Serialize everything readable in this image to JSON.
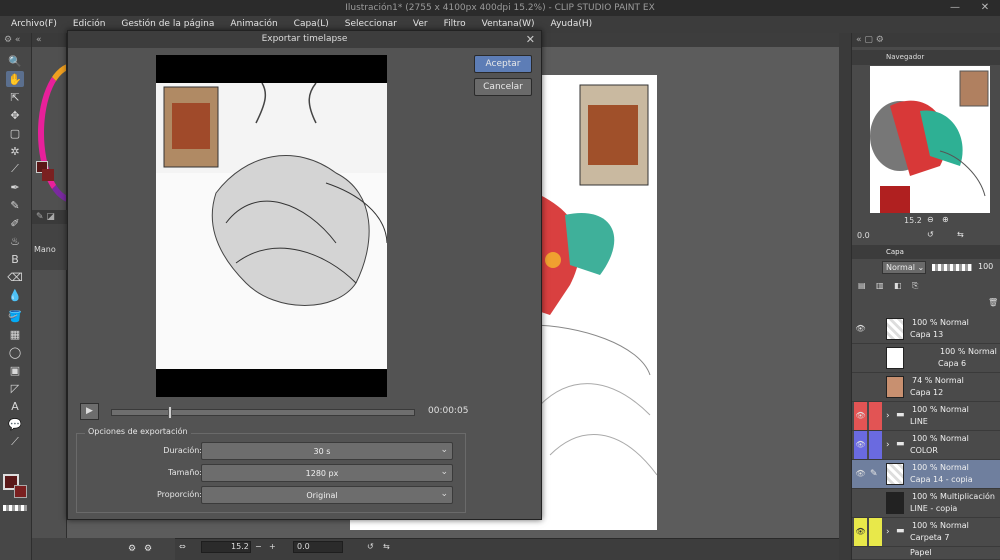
{
  "window": {
    "title": "Ilustración1* (2755 x 4100px 400dpi 15.2%) - CLIP STUDIO PAINT EX"
  },
  "menu": [
    "Archivo(F)",
    "Edición",
    "Gestión de la página",
    "Animación",
    "Capa(L)",
    "Seleccionar",
    "Ver",
    "Filtro",
    "Ventana(W)",
    "Ayuda(H)"
  ],
  "subtool": {
    "label": "Mano"
  },
  "dialog": {
    "title": "Exportar timelapse",
    "accept": "Aceptar",
    "cancel": "Cancelar",
    "timecode": "00:00:05",
    "playback_position": 0.19,
    "options_title": "Opciones de exportación",
    "rows": [
      {
        "label": "Duración:",
        "value": "30 s"
      },
      {
        "label": "Tamaño:",
        "value": "1280 px"
      },
      {
        "label": "Proporción:",
        "value": "Original"
      }
    ]
  },
  "navigator": {
    "tab": "Navegador",
    "zoom": "15.2",
    "rotation": "0.0"
  },
  "status": {
    "zoom": "15.2",
    "rotation": "0.0"
  },
  "layers": {
    "tab": "Capa",
    "blend": "Normal",
    "opacity": "100",
    "items": [
      {
        "mode": "100 % Normal",
        "name": "Capa 13",
        "eye": "👁",
        "marker": ""
      },
      {
        "mode": "100 % Normal",
        "name": "Capa 6",
        "eye": "",
        "marker": ""
      },
      {
        "mode": "74 % Normal",
        "name": "Capa 12",
        "eye": "",
        "marker": ""
      },
      {
        "mode": "100 % Normal",
        "name": "LINE",
        "eye": "👁",
        "marker": "#e25454"
      },
      {
        "mode": "100 % Normal",
        "name": "COLOR",
        "eye": "👁",
        "marker": "#6a6ae0"
      },
      {
        "mode": "100 % Normal",
        "name": "Capa 14 - copia",
        "eye": "👁",
        "marker": ""
      },
      {
        "mode": "100 % Multiplicación",
        "name": "LINE - copia",
        "eye": "",
        "marker": ""
      },
      {
        "mode": "100 % Normal",
        "name": "Carpeta 7",
        "eye": "👁",
        "marker": "#e8e84a"
      },
      {
        "mode": "",
        "name": "Papel",
        "eye": "👁",
        "marker": ""
      }
    ]
  },
  "colors": {
    "accent": "#5d7db6",
    "selected_layer": "#6f7f9e"
  }
}
